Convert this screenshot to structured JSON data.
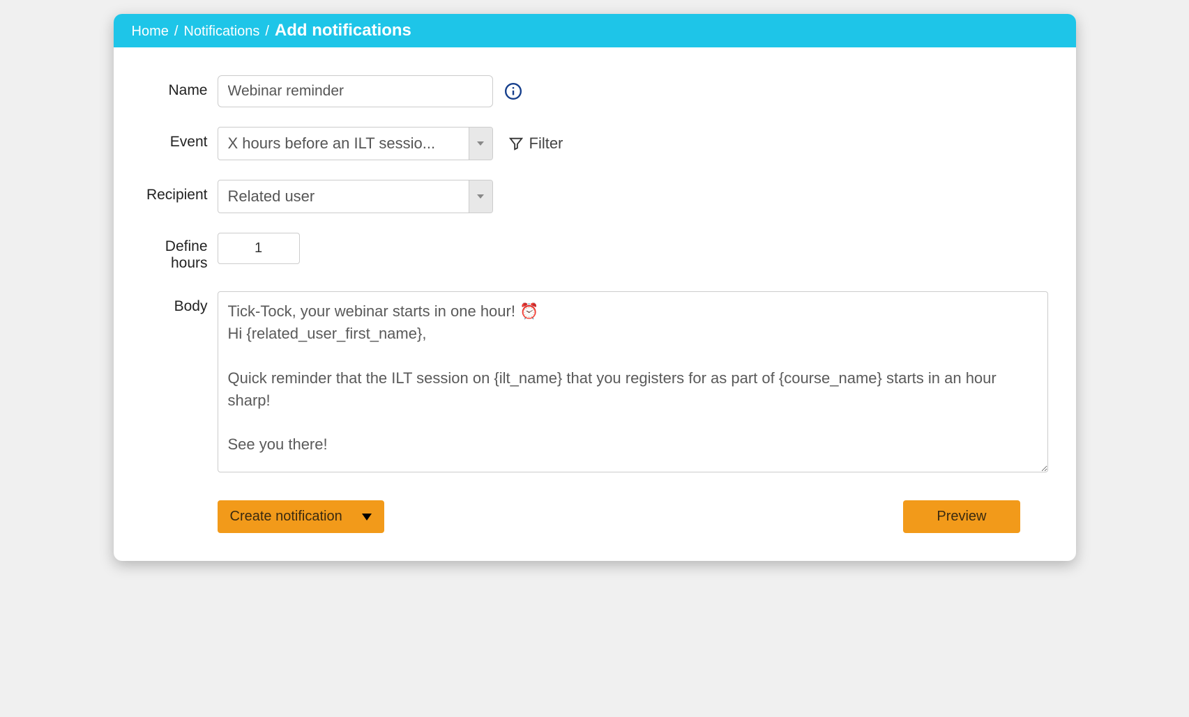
{
  "breadcrumb": {
    "home": "Home",
    "notifications": "Notifications",
    "current": "Add notifications"
  },
  "labels": {
    "name": "Name",
    "event": "Event",
    "recipient": "Recipient",
    "define_hours": "Define hours",
    "body": "Body"
  },
  "fields": {
    "name_value": "Webinar reminder",
    "event_value": "X hours before an ILT sessio...",
    "recipient_value": "Related user",
    "hours_value": "1",
    "body_value": "Tick-Tock, your webinar starts in one hour! ⏰\nHi {related_user_first_name},\n\nQuick reminder that the ILT session on {ilt_name} that you registers for as part of {course_name} starts in an hour sharp!\n\nSee you there!"
  },
  "filter_label": "Filter",
  "buttons": {
    "create": "Create notification",
    "preview": "Preview"
  }
}
